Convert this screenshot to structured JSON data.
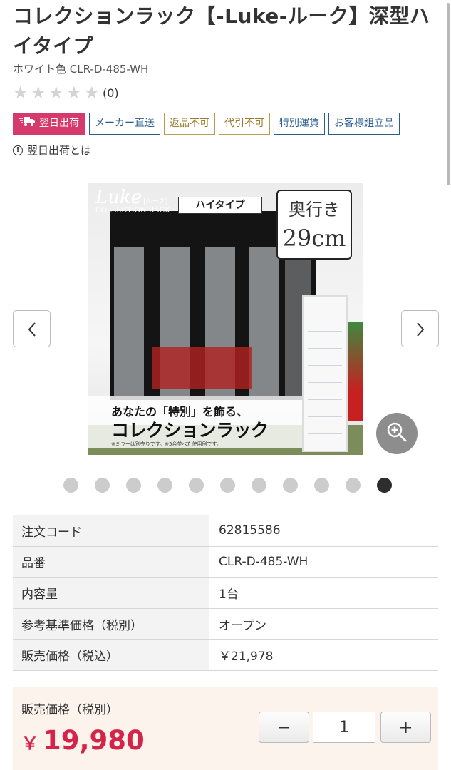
{
  "product": {
    "title": "コレクションラック【-Luke-ルーク】深型ハイタイプ",
    "subtitle": "ホワイト色 CLR-D-485-WH",
    "rating_count": "(0)",
    "stars": 0
  },
  "tags": [
    {
      "label": "翌日出荷",
      "style": "red",
      "icon": "truck-icon"
    },
    {
      "label": "メーカー直送",
      "style": "blue"
    },
    {
      "label": "返品不可",
      "style": "gold"
    },
    {
      "label": "代引不可",
      "style": "gold"
    },
    {
      "label": "特別運賃",
      "style": "blue"
    },
    {
      "label": "お客様組立品",
      "style": "blue"
    }
  ],
  "shipping_note": {
    "icon": "info-icon",
    "link_text": "翌日出荷とは"
  },
  "gallery": {
    "logo": "Luke",
    "logo_small": "[ルーク]",
    "logo_sub": "COLLECTION RACK",
    "type_badge": "ハイタイプ",
    "depth_label": "奥行き",
    "depth_value": "29cm",
    "tagline_1": "あなたの「特別」を飾る、",
    "tagline_2": "コレクションラック",
    "note": "※ミラーは別売りです。※5台並べた使用例です。",
    "prev_icon": "chevron-left-icon",
    "next_icon": "chevron-right-icon",
    "zoom_icon": "zoom-in-icon",
    "dot_count": 11,
    "active_dot": 11
  },
  "specs": [
    {
      "label": "注文コード",
      "value": "62815586"
    },
    {
      "label": "品番",
      "value": "CLR-D-485-WH"
    },
    {
      "label": "内容量",
      "value": "1台"
    },
    {
      "label": "参考基準価格（税別）",
      "value": "オープン"
    },
    {
      "label": "販売価格（税込）",
      "value": "￥21,978"
    }
  ],
  "price": {
    "label": "販売価格（税別）",
    "currency": "￥",
    "amount": "19,980"
  },
  "quantity": {
    "minus": "−",
    "value": "1",
    "plus": "+"
  },
  "colors": {
    "accent_red": "#d63a6d",
    "price_red": "#d6234a",
    "tag_blue": "#2a5d8f",
    "tag_gold": "#9a7a2c",
    "price_bg": "#fdf3ed"
  }
}
